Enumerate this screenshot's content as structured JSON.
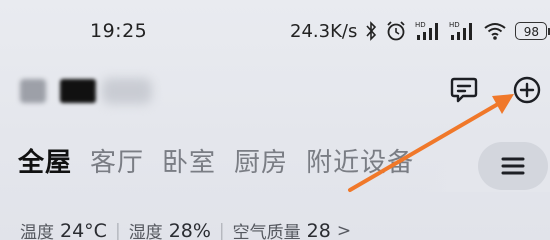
{
  "status_bar": {
    "time": "19:25",
    "net_speed": "24.3K/s",
    "hd_badge": "HD",
    "battery": "98",
    "icons": [
      "bluetooth-icon",
      "alarm-icon",
      "hd-signal-icon",
      "hd-signal-icon",
      "wifi-icon",
      "battery-icon"
    ]
  },
  "header": {
    "home_name_obscured": true,
    "icons": [
      "message-icon",
      "add-icon"
    ]
  },
  "tabs": [
    {
      "label": "全屋",
      "active": true
    },
    {
      "label": "客厅",
      "active": false
    },
    {
      "label": "卧室",
      "active": false
    },
    {
      "label": "厨房",
      "active": false
    },
    {
      "label": "附近设备",
      "active": false
    }
  ],
  "menu_icon": "hamburger-menu-icon",
  "environment": {
    "temperature_label": "温度",
    "temperature_value": "24°C",
    "humidity_label": "湿度",
    "humidity_value": "28%",
    "air_label": "空气质量",
    "air_value": "28",
    "more": ">"
  },
  "annotation": {
    "arrow_color": "#f0782a"
  }
}
